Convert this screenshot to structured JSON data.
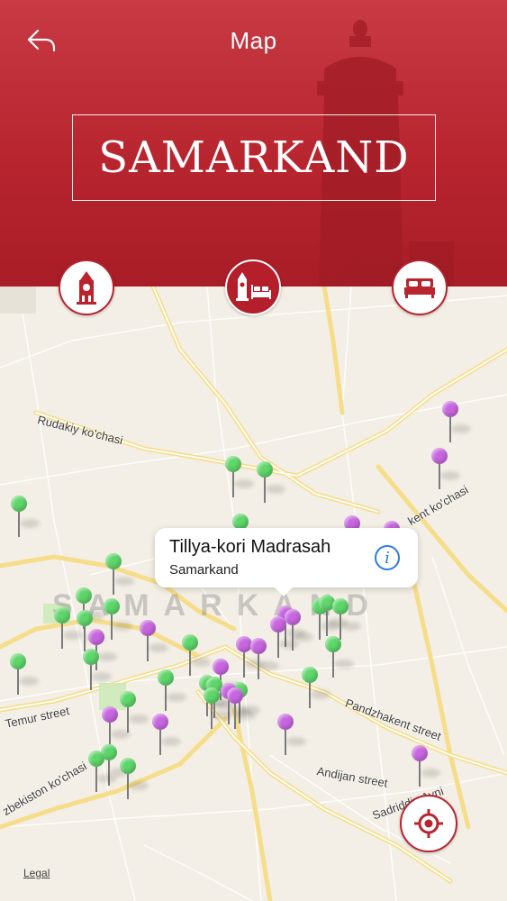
{
  "header": {
    "title": "Map",
    "city": "SAMARKAND",
    "background_color": "#b8252f"
  },
  "categories": [
    {
      "id": "sights",
      "icon": "clock-tower-icon",
      "active": false
    },
    {
      "id": "all",
      "icon": "tower-and-bed-icon",
      "active": true
    },
    {
      "id": "hotels",
      "icon": "bed-icon",
      "active": false
    }
  ],
  "map": {
    "city_label": "SAMARKAND",
    "street_labels": {
      "rudakiy": "Rudakiy ko'chasi",
      "temur": "Temur street",
      "uzbekiston": "zbekiston ko'chasi",
      "pandzhakent": "Pandzhakent street",
      "andijan": "Andijan street",
      "sadriddin": "Sadriddin Ayni",
      "kent": "kent ko'chasi"
    },
    "legal": "Legal"
  },
  "callout": {
    "title": "Tillya-kori Madrasah",
    "subtitle": "Samarkand",
    "info_icon": "info-icon"
  },
  "pin_colors": {
    "sight": "#5ed66a",
    "hotel": "#c866e0"
  },
  "locate_button": {
    "icon": "locate-me-icon"
  }
}
